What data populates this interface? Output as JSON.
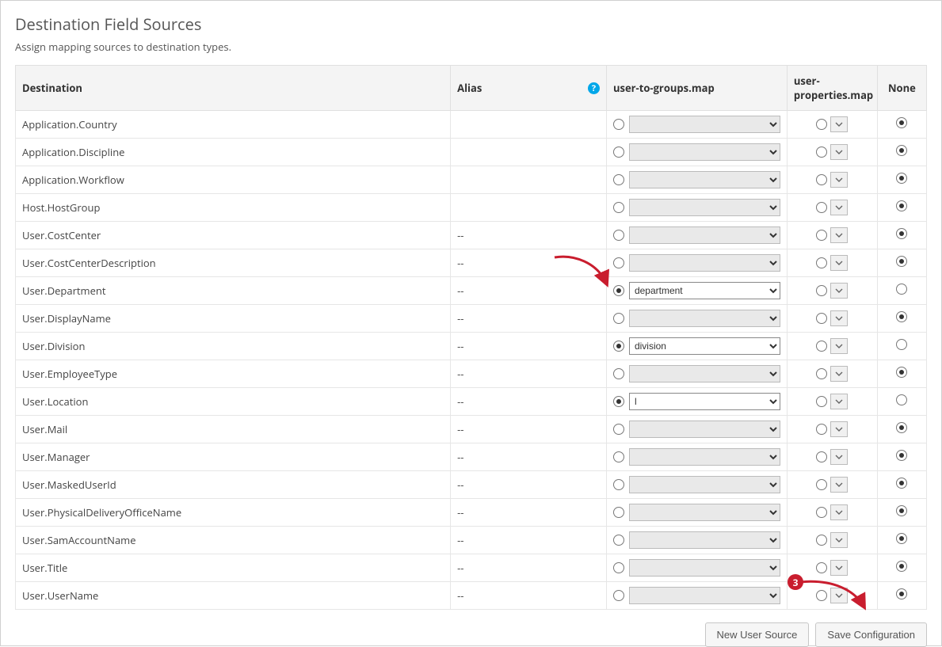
{
  "panel": {
    "title": "Destination Field Sources",
    "subtitle": "Assign mapping sources to destination types."
  },
  "columns": {
    "destination": "Destination",
    "alias": "Alias",
    "source_utg": "user-to-groups.map",
    "source_up": "user-properties.map",
    "none": "None"
  },
  "rows": [
    {
      "destination": "Application.Country",
      "alias": "",
      "selected": "none",
      "utg_value": ""
    },
    {
      "destination": "Application.Discipline",
      "alias": "",
      "selected": "none",
      "utg_value": ""
    },
    {
      "destination": "Application.Workflow",
      "alias": "",
      "selected": "none",
      "utg_value": ""
    },
    {
      "destination": "Host.HostGroup",
      "alias": "",
      "selected": "none",
      "utg_value": ""
    },
    {
      "destination": "User.CostCenter",
      "alias": "--",
      "selected": "none",
      "utg_value": ""
    },
    {
      "destination": "User.CostCenterDescription",
      "alias": "--",
      "selected": "none",
      "utg_value": ""
    },
    {
      "destination": "User.Department",
      "alias": "--",
      "selected": "utg",
      "utg_value": "department"
    },
    {
      "destination": "User.DisplayName",
      "alias": "--",
      "selected": "none",
      "utg_value": ""
    },
    {
      "destination": "User.Division",
      "alias": "--",
      "selected": "utg",
      "utg_value": "division"
    },
    {
      "destination": "User.EmployeeType",
      "alias": "--",
      "selected": "none",
      "utg_value": ""
    },
    {
      "destination": "User.Location",
      "alias": "--",
      "selected": "utg",
      "utg_value": "l"
    },
    {
      "destination": "User.Mail",
      "alias": "--",
      "selected": "none",
      "utg_value": ""
    },
    {
      "destination": "User.Manager",
      "alias": "--",
      "selected": "none",
      "utg_value": ""
    },
    {
      "destination": "User.MaskedUserId",
      "alias": "--",
      "selected": "none",
      "utg_value": ""
    },
    {
      "destination": "User.PhysicalDeliveryOfficeName",
      "alias": "--",
      "selected": "none",
      "utg_value": ""
    },
    {
      "destination": "User.SamAccountName",
      "alias": "--",
      "selected": "none",
      "utg_value": ""
    },
    {
      "destination": "User.Title",
      "alias": "--",
      "selected": "none",
      "utg_value": ""
    },
    {
      "destination": "User.UserName",
      "alias": "--",
      "selected": "none",
      "utg_value": ""
    }
  ],
  "utg_options": [
    "",
    "department",
    "division",
    "l"
  ],
  "buttons": {
    "new_source": "New User Source",
    "save": "Save Configuration"
  },
  "callout": {
    "badge": "3"
  },
  "icons": {
    "help": "?"
  }
}
